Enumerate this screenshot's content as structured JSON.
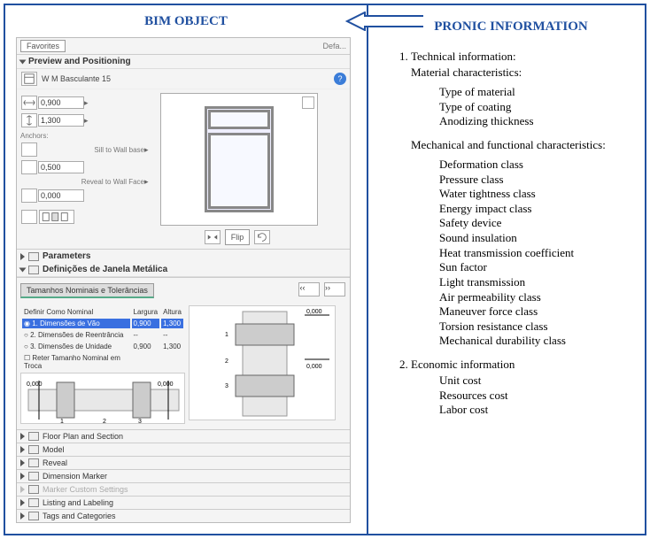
{
  "headings": {
    "left": "BIM OBJECT",
    "right": "PRONIC INFORMATION"
  },
  "app": {
    "favorites": "Favorites",
    "default_label": "Defa...",
    "preview_section": "Preview and Positioning",
    "module_name": "W M Basculante 15",
    "inputs": {
      "v1": "0,900",
      "v2": "1,300",
      "v3": "0,500",
      "v4": "0,000"
    },
    "anchors_label": "Anchors:",
    "sill_label": "Sill to Wall base",
    "reveal_label": "Reveal to Wall Face",
    "flip": "Flip",
    "parameters": "Parameters",
    "definitions": "Definições de Janela Metálica",
    "nominal_tab": "Tamanhos Nominais e Tolerâncias",
    "table_hdr": {
      "define": "Definir Como Nominal",
      "largura": "Largura",
      "altura": "Altura"
    },
    "rows": [
      {
        "label": "1. Dimensões de Vão",
        "w": "0,900",
        "h": "1,300",
        "active": true
      },
      {
        "label": "2. Dimensões de Reentrância",
        "w": "--",
        "h": "--",
        "active": false
      },
      {
        "label": "3. Dimensões de Unidade",
        "w": "0,900",
        "h": "1,300",
        "active": false
      },
      {
        "label": "Reter Tamanho Nominal em Troca",
        "w": "",
        "h": "",
        "active": false
      }
    ],
    "dim_zero": "0,000",
    "closed_sections": [
      "Floor Plan and Section",
      "Model",
      "Reveal",
      "Dimension Marker",
      "Marker Custom Settings",
      "Listing and Labeling",
      "Tags and Categories"
    ]
  },
  "info": {
    "section1": {
      "title": "Technical information:"
    },
    "material": {
      "heading": "Material characteristics:",
      "items": [
        "Type of material",
        "Type of coating",
        "Anodizing thickness"
      ]
    },
    "mechanical": {
      "heading": "Mechanical and functional characteristics:",
      "items": [
        "Deformation class",
        "Pressure class",
        "Water tightness class",
        "Energy impact class",
        "Safety device",
        "Sound insulation",
        "Heat transmission coefficient",
        "Sun factor",
        "Light transmission",
        "Air permeability class",
        "Maneuver force class",
        "Torsion resistance class",
        "Mechanical durability class"
      ]
    },
    "section2": {
      "title": "Economic information"
    },
    "economic": {
      "items": [
        "Unit cost",
        "Resources cost",
        "Labor cost"
      ]
    }
  }
}
